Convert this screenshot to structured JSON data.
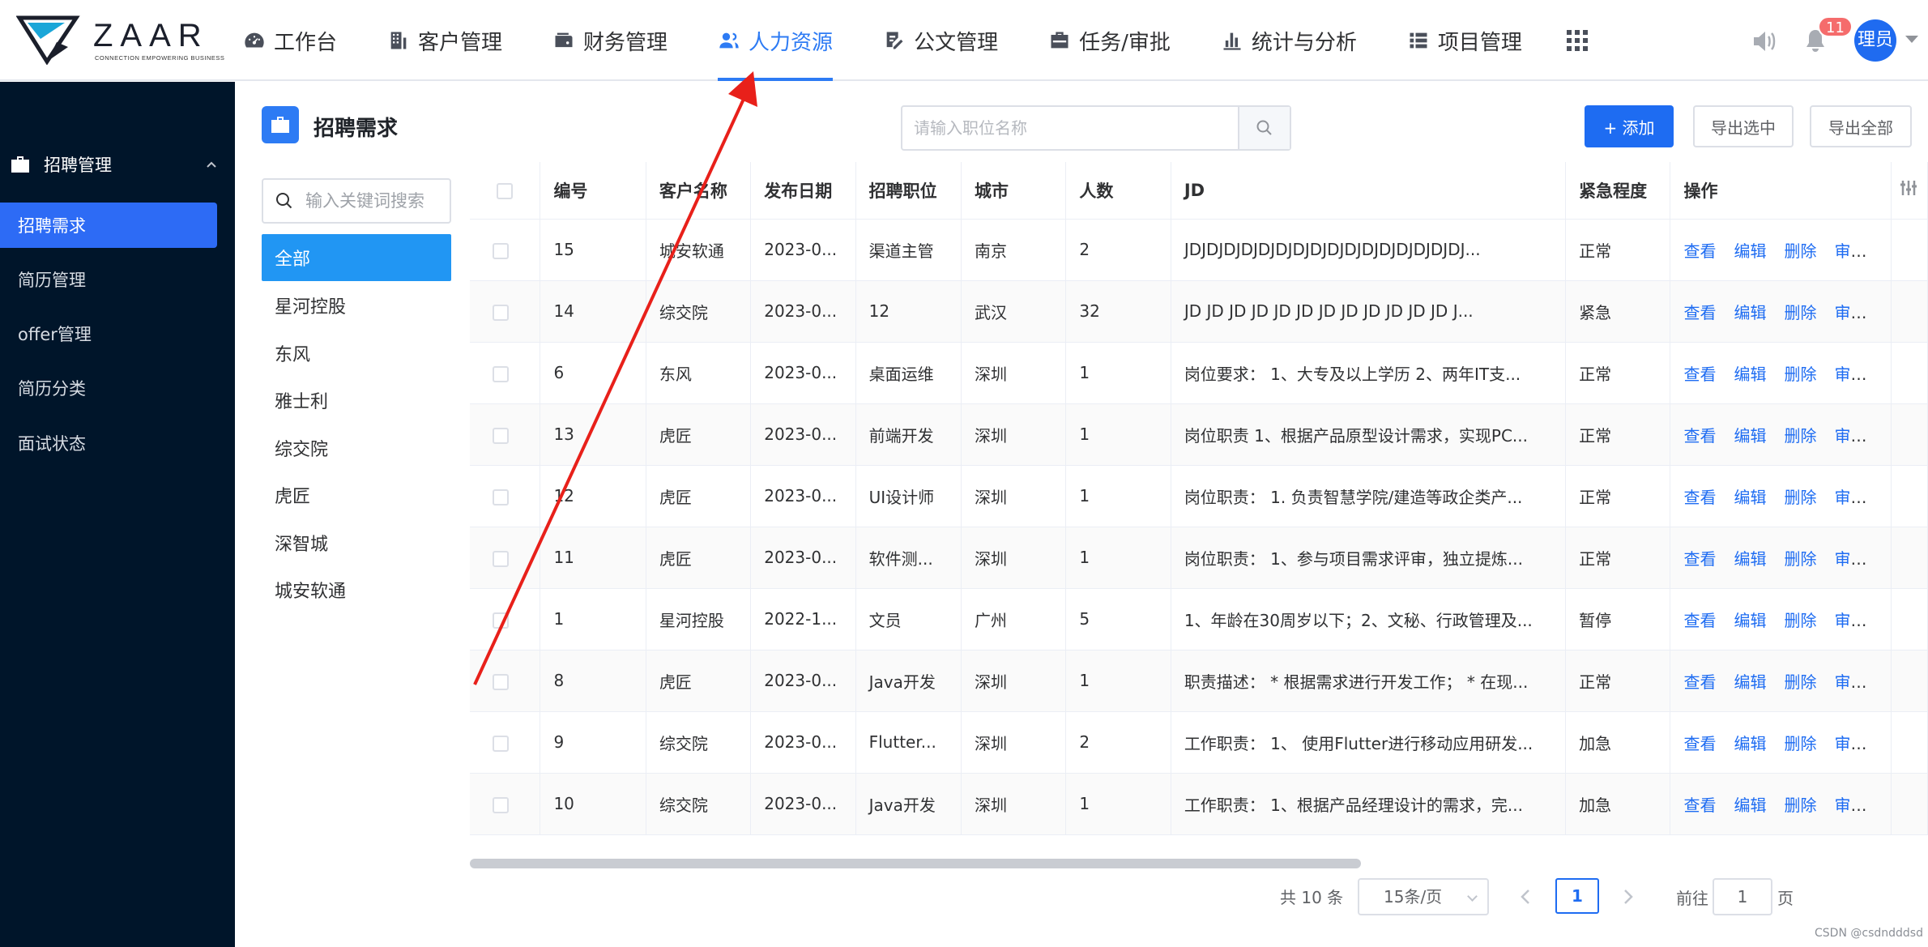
{
  "brand": {
    "name": "ZAAR",
    "tagline": "CONNECTION EMPOWERING BUSINESS"
  },
  "nav": {
    "items": [
      {
        "label": "工作台",
        "icon": "dashboard-icon"
      },
      {
        "label": "客户管理",
        "icon": "building-icon"
      },
      {
        "label": "财务管理",
        "icon": "wallet-icon"
      },
      {
        "label": "人力资源",
        "icon": "user-group-icon",
        "active": true
      },
      {
        "label": "公文管理",
        "icon": "document-edit-icon"
      },
      {
        "label": "任务/审批",
        "icon": "briefcase-icon"
      },
      {
        "label": "统计与分析",
        "icon": "bar-chart-icon"
      },
      {
        "label": "项目管理",
        "icon": "list-icon"
      }
    ],
    "apps_icon": "apps-grid-icon"
  },
  "header_right": {
    "notification_count": "11",
    "user_label": "理员"
  },
  "sidebar": {
    "group_label": "招聘管理",
    "items": [
      {
        "label": "招聘需求",
        "active": true
      },
      {
        "label": "简历管理"
      },
      {
        "label": "offer管理"
      },
      {
        "label": "简历分类"
      },
      {
        "label": "面试状态"
      }
    ]
  },
  "page": {
    "title": "招聘需求",
    "search_placeholder": "请输入职位名称",
    "add_label": "+ 添加",
    "export_selected_label": "导出选中",
    "export_all_label": "导出全部"
  },
  "customer_filter": {
    "placeholder": "输入关键词搜索",
    "items": [
      "全部",
      "星河控股",
      "东风",
      "雅士利",
      "综交院",
      "虎匠",
      "深智城",
      "城安软通"
    ]
  },
  "table": {
    "columns": [
      "编号",
      "客户名称",
      "发布日期",
      "招聘职位",
      "城市",
      "人数",
      "JD",
      "紧急程度",
      "操作"
    ],
    "actions": [
      "查看",
      "编辑",
      "删除",
      "审核"
    ],
    "rows": [
      {
        "id": "15",
        "customer": "城安软通",
        "date": "2023-0...",
        "position": "渠道主管",
        "city": "南京",
        "count": "2",
        "jd": "JDJDJDJDJDJDJDJDJDJDJDJDJDJDJDJDJ...",
        "urgency": "正常"
      },
      {
        "id": "14",
        "customer": "综交院",
        "date": "2023-0...",
        "position": "12",
        "city": "武汉",
        "count": "32",
        "jd": "JD JD JD JD JD JD JD JD JD JD JD JD J...",
        "urgency": "紧急"
      },
      {
        "id": "6",
        "customer": "东风",
        "date": "2023-0...",
        "position": "桌面运维",
        "city": "深圳",
        "count": "1",
        "jd": "岗位要求： 1、大专及以上学历 2、两年IT支...",
        "urgency": "正常"
      },
      {
        "id": "13",
        "customer": "虎匠",
        "date": "2023-0...",
        "position": "前端开发",
        "city": "深圳",
        "count": "1",
        "jd": "岗位职责 1、根据产品原型设计需求，实现PC...",
        "urgency": "正常"
      },
      {
        "id": "12",
        "customer": "虎匠",
        "date": "2023-0...",
        "position": "UI设计师",
        "city": "深圳",
        "count": "1",
        "jd": "岗位职责： 1. 负责智慧学院/建造等政企类产...",
        "urgency": "正常"
      },
      {
        "id": "11",
        "customer": "虎匠",
        "date": "2023-0...",
        "position": "软件测...",
        "city": "深圳",
        "count": "1",
        "jd": "岗位职责： 1、参与项目需求评审，独立提炼...",
        "urgency": "正常"
      },
      {
        "id": "1",
        "customer": "星河控股",
        "date": "2022-1...",
        "position": "文员",
        "city": "广州",
        "count": "5",
        "jd": "1、年龄在30周岁以下；2、文秘、行政管理及...",
        "urgency": "暂停"
      },
      {
        "id": "8",
        "customer": "虎匠",
        "date": "2023-0...",
        "position": "Java开发",
        "city": "深圳",
        "count": "1",
        "jd": "职责描述： * 根据需求进行开发工作； * 在现...",
        "urgency": "正常"
      },
      {
        "id": "9",
        "customer": "综交院",
        "date": "2023-0...",
        "position": "Flutter...",
        "city": "深圳",
        "count": "2",
        "jd": "工作职责： 1、 使用Flutter进行移动应用研发...",
        "urgency": "加急"
      },
      {
        "id": "10",
        "customer": "综交院",
        "date": "2023-0...",
        "position": "Java开发",
        "city": "深圳",
        "count": "1",
        "jd": "工作职责： 1、根据产品经理设计的需求，完...",
        "urgency": "加急"
      }
    ]
  },
  "pagination": {
    "total_text": "共 10 条",
    "page_size_label": "15条/页",
    "current_page": "1",
    "goto_label": "前往",
    "goto_value": "1",
    "page_suffix": "页"
  },
  "watermark": "CSDN @csdndddsd",
  "colors": {
    "primary": "#2d7bf4",
    "sidebar_bg": "#00152a",
    "annotation_arrow": "#e8201a",
    "badge": "#f56c6c"
  }
}
